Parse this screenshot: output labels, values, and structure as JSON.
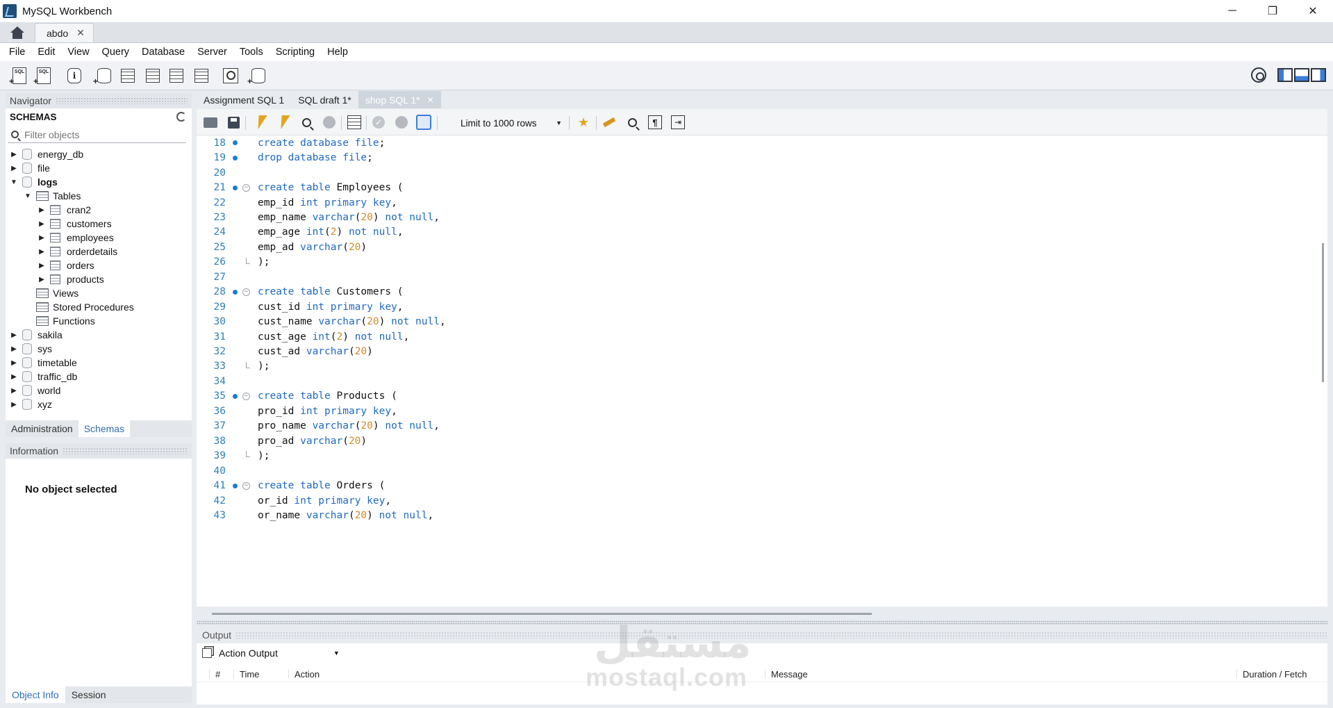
{
  "window": {
    "title": "MySQL Workbench",
    "minimize": "─",
    "restore": "❐",
    "close": "✕"
  },
  "connection_tab": {
    "label": "abdo",
    "close": "✕"
  },
  "menu": [
    "File",
    "Edit",
    "View",
    "Query",
    "Database",
    "Server",
    "Tools",
    "Scripting",
    "Help"
  ],
  "navigator": {
    "title": "Navigator",
    "schemas_title": "SCHEMAS",
    "filter_placeholder": "Filter objects",
    "tree": [
      {
        "label": "energy_db",
        "level": 0,
        "type": "db",
        "arrow": "▶"
      },
      {
        "label": "file",
        "level": 0,
        "type": "db",
        "arrow": "▶"
      },
      {
        "label": "logs",
        "level": 0,
        "type": "db",
        "arrow": "▼",
        "bold": true
      },
      {
        "label": "Tables",
        "level": 1,
        "type": "folder",
        "arrow": "▼"
      },
      {
        "label": "cran2",
        "level": 2,
        "type": "table",
        "arrow": "▶"
      },
      {
        "label": "customers",
        "level": 2,
        "type": "table",
        "arrow": "▶"
      },
      {
        "label": "employees",
        "level": 2,
        "type": "table",
        "arrow": "▶"
      },
      {
        "label": "orderdetails",
        "level": 2,
        "type": "table",
        "arrow": "▶"
      },
      {
        "label": "orders",
        "level": 2,
        "type": "table",
        "arrow": "▶"
      },
      {
        "label": "products",
        "level": 2,
        "type": "table",
        "arrow": "▶"
      },
      {
        "label": "Views",
        "level": 1,
        "type": "folder",
        "arrow": ""
      },
      {
        "label": "Stored Procedures",
        "level": 1,
        "type": "folder",
        "arrow": ""
      },
      {
        "label": "Functions",
        "level": 1,
        "type": "folder",
        "arrow": ""
      },
      {
        "label": "sakila",
        "level": 0,
        "type": "db",
        "arrow": "▶"
      },
      {
        "label": "sys",
        "level": 0,
        "type": "db",
        "arrow": "▶"
      },
      {
        "label": "timetable",
        "level": 0,
        "type": "db",
        "arrow": "▶"
      },
      {
        "label": "traffic_db",
        "level": 0,
        "type": "db",
        "arrow": "▶"
      },
      {
        "label": "world",
        "level": 0,
        "type": "db",
        "arrow": "▶"
      },
      {
        "label": "xyz",
        "level": 0,
        "type": "db",
        "arrow": "▶"
      }
    ],
    "tabs": [
      "Administration",
      "Schemas"
    ],
    "active_tab": "Schemas"
  },
  "information": {
    "title": "Information",
    "body": "No object selected",
    "tabs": [
      "Object Info",
      "Session"
    ]
  },
  "sql_tabs": [
    {
      "label": "Assignment SQL 1",
      "active": false
    },
    {
      "label": "SQL draft 1*",
      "active": false
    },
    {
      "label": "shop SQL 1*",
      "active": true,
      "close": "✕"
    }
  ],
  "editor_toolbar": {
    "limit_label": "Limit to 1000 rows",
    "caret": "▼",
    "para": "¶",
    "wrap": "⇥",
    "check": "✓",
    "star": "★"
  },
  "code_lines": [
    {
      "n": "18",
      "bp": true,
      "fold": "",
      "tokens": [
        [
          "kw",
          "create database "
        ],
        [
          "kw",
          "file"
        ],
        [
          "",
          "; "
        ]
      ]
    },
    {
      "n": "19",
      "bp": true,
      "fold": "",
      "tokens": [
        [
          "kw",
          "drop database "
        ],
        [
          "kw",
          "file"
        ],
        [
          "",
          ";"
        ]
      ]
    },
    {
      "n": "20",
      "bp": false,
      "fold": "",
      "tokens": []
    },
    {
      "n": "21",
      "bp": true,
      "fold": "open",
      "tokens": [
        [
          "kw",
          "create table "
        ],
        [
          "",
          "Employees ("
        ]
      ]
    },
    {
      "n": "22",
      "bp": false,
      "fold": "",
      "tokens": [
        [
          "",
          "emp_id "
        ],
        [
          "kw",
          "int primary key"
        ],
        [
          "",
          ","
        ]
      ]
    },
    {
      "n": "23",
      "bp": false,
      "fold": "",
      "tokens": [
        [
          "",
          "emp_name "
        ],
        [
          "kw",
          "varchar"
        ],
        [
          "",
          "("
        ],
        [
          "num",
          "20"
        ],
        [
          "",
          ") "
        ],
        [
          "kw",
          "not null"
        ],
        [
          "",
          ","
        ]
      ]
    },
    {
      "n": "24",
      "bp": false,
      "fold": "",
      "tokens": [
        [
          "",
          "emp_age "
        ],
        [
          "kw",
          "int"
        ],
        [
          "",
          "("
        ],
        [
          "num",
          "2"
        ],
        [
          "",
          ") "
        ],
        [
          "kw",
          "not null"
        ],
        [
          "",
          ","
        ]
      ]
    },
    {
      "n": "25",
      "bp": false,
      "fold": "",
      "tokens": [
        [
          "",
          "emp_ad "
        ],
        [
          "kw",
          "varchar"
        ],
        [
          "",
          "("
        ],
        [
          "num",
          "20"
        ],
        [
          "",
          ")"
        ]
      ]
    },
    {
      "n": "26",
      "bp": false,
      "fold": "end",
      "tokens": [
        [
          "",
          ");"
        ]
      ]
    },
    {
      "n": "27",
      "bp": false,
      "fold": "",
      "tokens": []
    },
    {
      "n": "28",
      "bp": true,
      "fold": "open",
      "tokens": [
        [
          "kw",
          "create table "
        ],
        [
          "",
          "Customers ("
        ]
      ]
    },
    {
      "n": "29",
      "bp": false,
      "fold": "",
      "tokens": [
        [
          "",
          "cust_id "
        ],
        [
          "kw",
          "int primary key"
        ],
        [
          "",
          ","
        ]
      ]
    },
    {
      "n": "30",
      "bp": false,
      "fold": "",
      "tokens": [
        [
          "",
          "cust_name "
        ],
        [
          "kw",
          "varchar"
        ],
        [
          "",
          "("
        ],
        [
          "num",
          "20"
        ],
        [
          "",
          ") "
        ],
        [
          "kw",
          "not null"
        ],
        [
          "",
          ","
        ]
      ]
    },
    {
      "n": "31",
      "bp": false,
      "fold": "",
      "tokens": [
        [
          "",
          "cust_age "
        ],
        [
          "kw",
          "int"
        ],
        [
          "",
          "("
        ],
        [
          "num",
          "2"
        ],
        [
          "",
          ") "
        ],
        [
          "kw",
          "not null"
        ],
        [
          "",
          ","
        ]
      ]
    },
    {
      "n": "32",
      "bp": false,
      "fold": "",
      "tokens": [
        [
          "",
          "cust_ad "
        ],
        [
          "kw",
          "varchar"
        ],
        [
          "",
          "("
        ],
        [
          "num",
          "20"
        ],
        [
          "",
          ")"
        ]
      ]
    },
    {
      "n": "33",
      "bp": false,
      "fold": "end",
      "tokens": [
        [
          "",
          ");"
        ]
      ]
    },
    {
      "n": "34",
      "bp": false,
      "fold": "",
      "tokens": []
    },
    {
      "n": "35",
      "bp": true,
      "fold": "open",
      "tokens": [
        [
          "kw",
          "create table "
        ],
        [
          "",
          "Products ("
        ]
      ]
    },
    {
      "n": "36",
      "bp": false,
      "fold": "",
      "tokens": [
        [
          "",
          "pro_id "
        ],
        [
          "kw",
          "int primary key"
        ],
        [
          "",
          ","
        ]
      ]
    },
    {
      "n": "37",
      "bp": false,
      "fold": "",
      "tokens": [
        [
          "",
          "pro_name "
        ],
        [
          "kw",
          "varchar"
        ],
        [
          "",
          "("
        ],
        [
          "num",
          "20"
        ],
        [
          "",
          ") "
        ],
        [
          "kw",
          "not null"
        ],
        [
          "",
          ","
        ]
      ]
    },
    {
      "n": "38",
      "bp": false,
      "fold": "",
      "tokens": [
        [
          "",
          "pro_ad "
        ],
        [
          "kw",
          "varchar"
        ],
        [
          "",
          "("
        ],
        [
          "num",
          "20"
        ],
        [
          "",
          ")"
        ]
      ]
    },
    {
      "n": "39",
      "bp": false,
      "fold": "end",
      "tokens": [
        [
          "",
          ");"
        ]
      ]
    },
    {
      "n": "40",
      "bp": false,
      "fold": "",
      "tokens": []
    },
    {
      "n": "41",
      "bp": true,
      "fold": "open",
      "tokens": [
        [
          "kw",
          "create table "
        ],
        [
          "",
          "Orders ("
        ]
      ]
    },
    {
      "n": "42",
      "bp": false,
      "fold": "",
      "tokens": [
        [
          "",
          "or_id "
        ],
        [
          "kw",
          "int primary key"
        ],
        [
          "",
          ","
        ]
      ]
    },
    {
      "n": "43",
      "bp": false,
      "fold": "",
      "tokens": [
        [
          "",
          "or_name "
        ],
        [
          "kw",
          "varchar"
        ],
        [
          "",
          "("
        ],
        [
          "num",
          "20"
        ],
        [
          "",
          ") "
        ],
        [
          "kw",
          "not null"
        ],
        [
          "",
          ","
        ]
      ]
    }
  ],
  "output": {
    "title": "Output",
    "selector": "Action Output",
    "caret": "▼",
    "columns": [
      "#",
      "Time",
      "Action",
      "Message",
      "Duration / Fetch"
    ]
  },
  "watermark": {
    "arabic": "مستقل",
    "latin": "mostaql.com"
  },
  "colors": {
    "keyword": "#1f69c2",
    "number": "#d38a2a",
    "line_number": "#2f7fb8",
    "active_tab_link": "#2f6db5"
  }
}
